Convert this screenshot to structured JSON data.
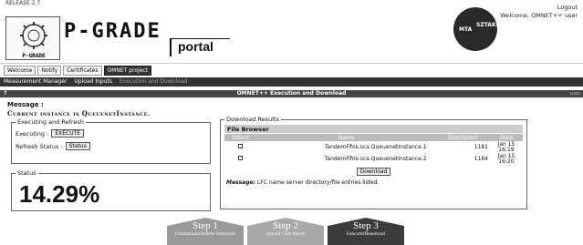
{
  "release": "RELEASE 2.7",
  "brand": {
    "logo_text": "P-GRADE",
    "logo_sub": "P-GRADE",
    "portal": "portal"
  },
  "partner": {
    "left": "MTA",
    "right": "SZTAKI"
  },
  "user": {
    "logout": "Logout",
    "welcome": "Welcome, OMNET++ user"
  },
  "tabs": [
    "Welcome",
    "Notify",
    "Certificates",
    "OMNET project"
  ],
  "subnav": [
    "Measurement Manager",
    "Upload Inputs",
    "Execution and Download"
  ],
  "panel": {
    "title": "OMNET++ Execution and Download",
    "help": "?",
    "controls": "▭▭"
  },
  "message": {
    "label": "Message :",
    "value": "Current instance is QueuenetInstance."
  },
  "execute_refresh": {
    "legend": "Executing and Refresh",
    "executing_label": "Executing :",
    "execute_btn": "EXECUTE",
    "refresh_label": "Refresh Status :",
    "status_btn": "Status"
  },
  "status": {
    "legend": "Status",
    "value": "14.29%"
  },
  "download": {
    "legend": "Download Results",
    "browser_title": "File Browser",
    "columns": [
      "Select",
      "Name",
      "Size(bytes)",
      "Date"
    ],
    "rows": [
      {
        "name": "TandemFifos.sca.QueuenetInstance.1",
        "size": "1181",
        "date1": "Jan 15",
        "date2": "16:19"
      },
      {
        "name": "TandemFifos.sca.QueuenetInstance.2",
        "size": "1184",
        "date1": "Jan 15",
        "date2": "16:20"
      }
    ],
    "download_btn": "Download",
    "msg_label": "Message:",
    "msg_text": "LFC name server directory/file entries listed"
  },
  "steps": [
    {
      "label": "Step 1",
      "sub": "Create/Load/Delete Instances"
    },
    {
      "label": "Step 2",
      "sub": "Upload / Set Inputs"
    },
    {
      "label": "Step 3",
      "sub": "Execute/Download"
    }
  ]
}
